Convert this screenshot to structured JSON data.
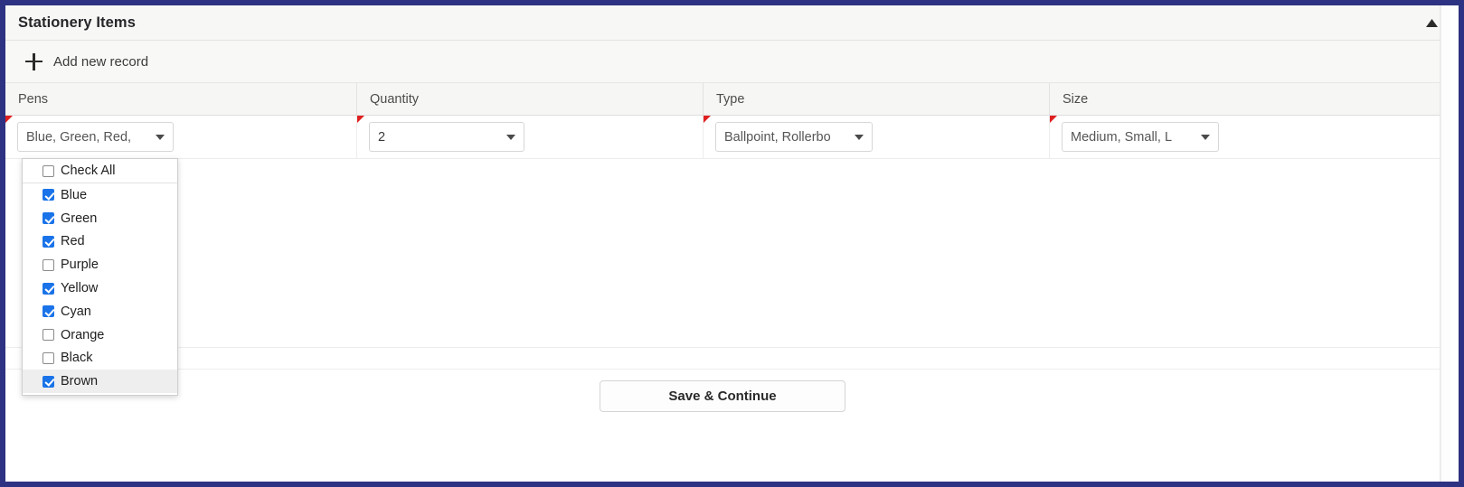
{
  "window": {
    "border_color": "#2d3282"
  },
  "panel": {
    "title": "Stationery Items",
    "collapse_icon": "triangle-up-icon"
  },
  "toolbar": {
    "add_record_label": "Add new record",
    "add_icon": "plus-icon"
  },
  "grid": {
    "columns": [
      {
        "header": "Pens"
      },
      {
        "header": "Quantity"
      },
      {
        "header": "Type"
      },
      {
        "header": "Size"
      }
    ],
    "row": {
      "pens_value": "Blue, Green, Red,",
      "quantity_value": "2",
      "type_value": "Ballpoint, Rollerbo",
      "size_value": "Medium, Small, L"
    }
  },
  "dropdown": {
    "open_for": "pens",
    "check_all_label": "Check All",
    "check_all_checked": false,
    "options": [
      {
        "label": "Blue",
        "checked": true,
        "highlighted": false
      },
      {
        "label": "Green",
        "checked": true,
        "highlighted": false
      },
      {
        "label": "Red",
        "checked": true,
        "highlighted": false
      },
      {
        "label": "Purple",
        "checked": false,
        "highlighted": false
      },
      {
        "label": "Yellow",
        "checked": true,
        "highlighted": false
      },
      {
        "label": "Cyan",
        "checked": true,
        "highlighted": false
      },
      {
        "label": "Orange",
        "checked": false,
        "highlighted": false
      },
      {
        "label": "Black",
        "checked": false,
        "highlighted": false
      },
      {
        "label": "Brown",
        "checked": true,
        "highlighted": true
      }
    ],
    "checkbox_color": "#1a73e8"
  },
  "footer": {
    "save_label": "Save & Continue"
  }
}
